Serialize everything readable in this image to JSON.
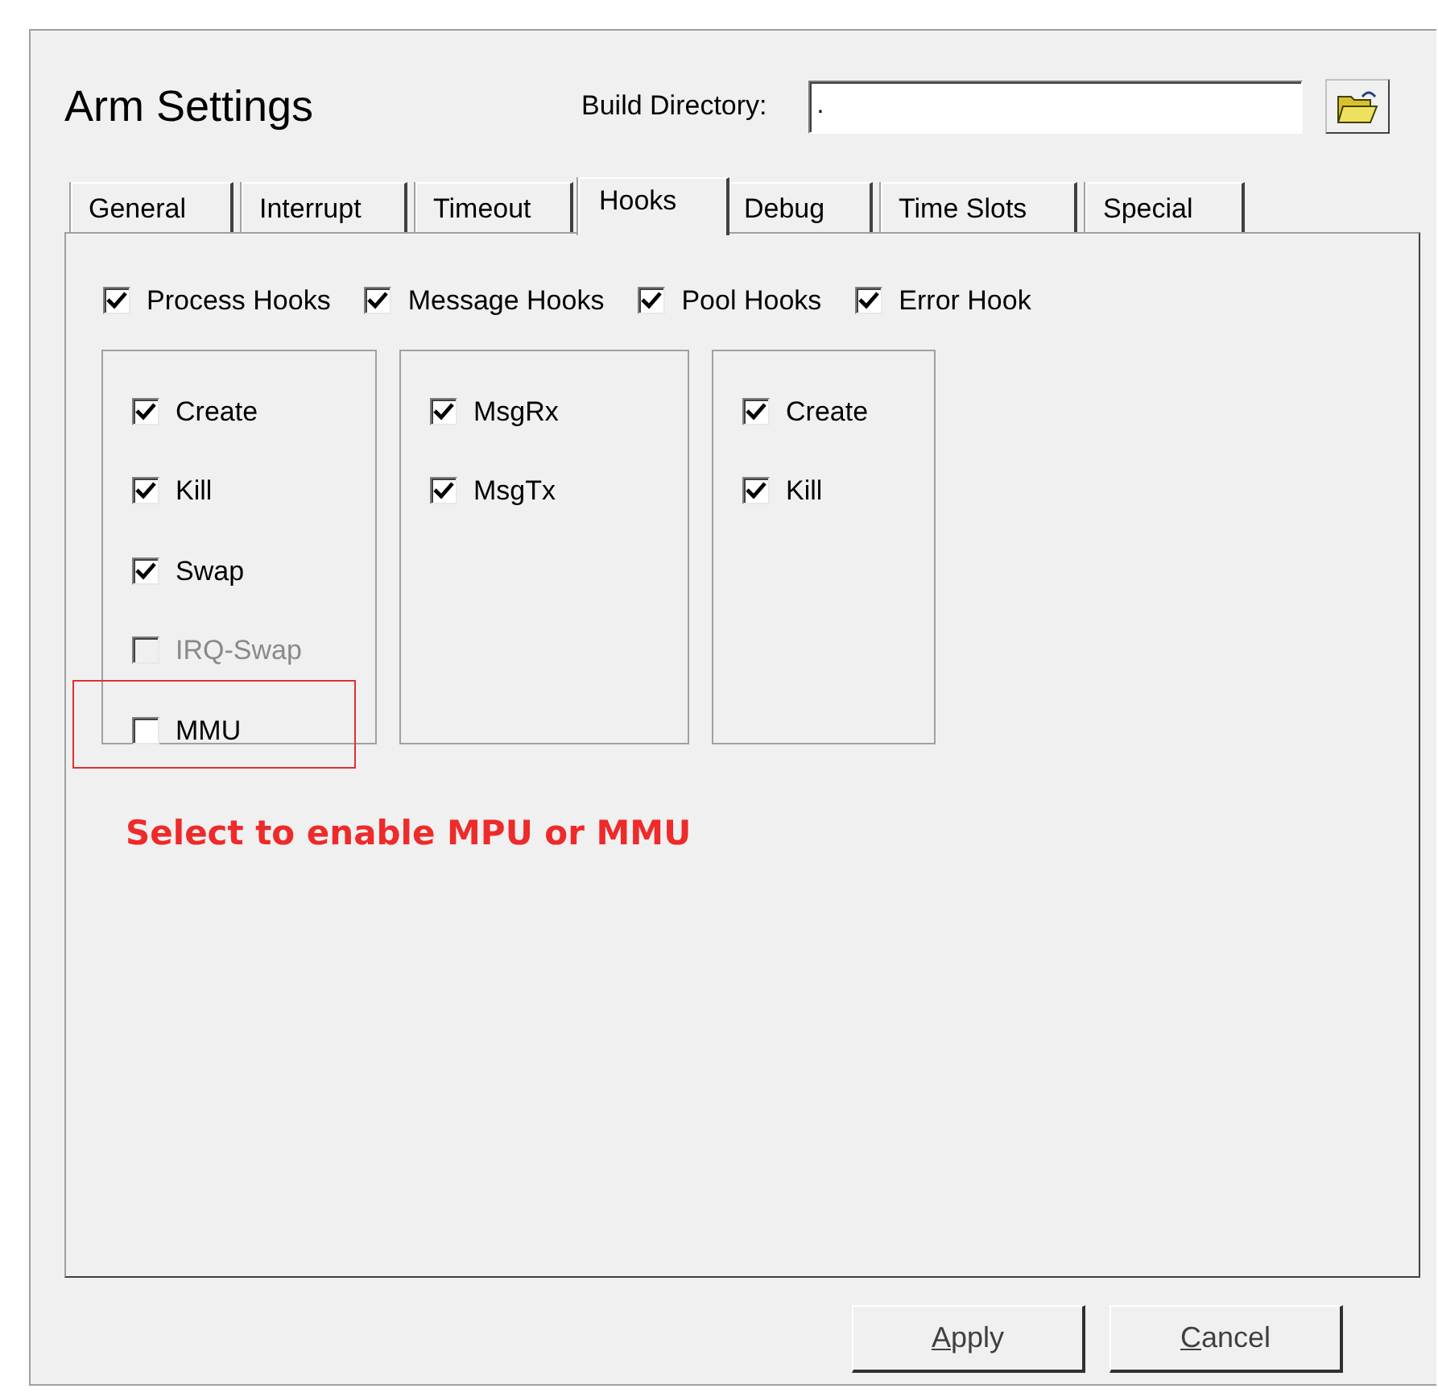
{
  "window": {
    "title": "Arm Settings"
  },
  "build_directory": {
    "label": "Build Directory:",
    "value": "."
  },
  "tabs": [
    {
      "label": "General",
      "selected": false
    },
    {
      "label": "Interrupt",
      "selected": false
    },
    {
      "label": "Timeout",
      "selected": false
    },
    {
      "label": "Hooks",
      "selected": true
    },
    {
      "label": "Debug",
      "selected": false
    },
    {
      "label": "Time Slots",
      "selected": false
    },
    {
      "label": "Special",
      "selected": false
    }
  ],
  "hook_types": [
    {
      "label": "Process Hooks",
      "checked": true
    },
    {
      "label": "Message Hooks",
      "checked": true
    },
    {
      "label": "Pool Hooks",
      "checked": true
    },
    {
      "label": "Error Hook",
      "checked": true
    }
  ],
  "groups": [
    {
      "items": [
        {
          "label": "Create",
          "checked": true,
          "disabled": false
        },
        {
          "label": "Kill",
          "checked": true,
          "disabled": false
        },
        {
          "label": "Swap",
          "checked": true,
          "disabled": false
        },
        {
          "label": "IRQ-Swap",
          "checked": false,
          "disabled": true
        },
        {
          "label": "MMU",
          "checked": false,
          "disabled": false,
          "highlighted": true
        }
      ]
    },
    {
      "items": [
        {
          "label": "MsgRx",
          "checked": true,
          "disabled": false
        },
        {
          "label": "MsgTx",
          "checked": true,
          "disabled": false
        }
      ]
    },
    {
      "items": [
        {
          "label": "Create",
          "checked": true,
          "disabled": false
        },
        {
          "label": "Kill",
          "checked": true,
          "disabled": false
        }
      ]
    }
  ],
  "annotation": "Select to enable MPU or MMU",
  "buttons": [
    {
      "label": "Apply"
    },
    {
      "label": "Cancel"
    }
  ]
}
